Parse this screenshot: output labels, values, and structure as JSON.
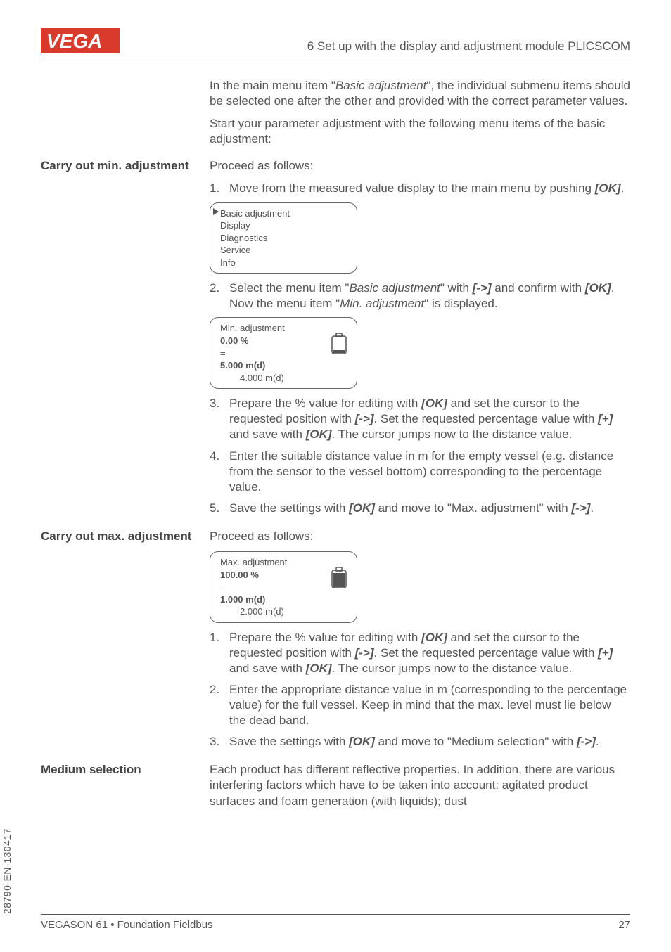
{
  "header": {
    "section_title": "6 Set up with the display and adjustment module PLICSCOM"
  },
  "intro": {
    "p1_a": "In the main menu item \"",
    "p1_i": "Basic adjustment",
    "p1_b": "\", the individual submenu items should be selected one after the other and provided with the correct parameter values.",
    "p2": "Start your parameter adjustment with the following menu items of the basic adjustment:"
  },
  "min": {
    "heading": "Carry out min. adjustment",
    "lead": "Proceed as follows:",
    "step1_a": "Move from the measured value display to the main menu by pushing ",
    "step1_ok": "[OK]",
    "step1_b": ".",
    "lcd1": {
      "l1": "Basic adjustment",
      "l2": "Display",
      "l3": "Diagnostics",
      "l4": "Service",
      "l5": "Info"
    },
    "step2_a": "Select the menu item \"",
    "step2_i1": "Basic adjustment",
    "step2_b": "\" with ",
    "step2_arrow": "[->]",
    "step2_c": " and confirm with ",
    "step2_ok": "[OK]",
    "step2_d": ". Now the menu item \"",
    "step2_i2": "Min. adjustment",
    "step2_e": "\" is displayed.",
    "lcd2": {
      "l1": "Min. adjustment",
      "l2": "0.00 %",
      "l3": "=",
      "l4": "5.000 m(d)",
      "l5": "4.000 m(d)"
    },
    "step3_a": "Prepare the % value for editing with ",
    "step3_ok1": "[OK]",
    "step3_b": " and set the cursor to the requested position with ",
    "step3_arrow": "[->]",
    "step3_c": ". Set the requested percentage value with ",
    "step3_plus": "[+]",
    "step3_d": " and save with ",
    "step3_ok2": "[OK]",
    "step3_e": ". The cursor jumps now to the distance value.",
    "step4": "Enter the suitable distance value in m for the empty vessel (e.g. distance from the sensor to the vessel bottom) corresponding to the percentage value.",
    "step5_a": "Save the settings with ",
    "step5_ok": "[OK]",
    "step5_b": " and move to \"Max. adjustment\" with ",
    "step5_arrow": "[->]",
    "step5_c": "."
  },
  "max": {
    "heading": "Carry out max. adjustment",
    "lead": "Proceed as follows:",
    "lcd": {
      "l1": "Max. adjustment",
      "l2": "100.00 %",
      "l3": "=",
      "l4": "1.000 m(d)",
      "l5": "2.000 m(d)"
    },
    "step1_a": "Prepare the % value for editing with ",
    "step1_ok1": "[OK]",
    "step1_b": " and set the cursor to the requested position with ",
    "step1_arrow": "[->]",
    "step1_c": ". Set the requested percentage value with ",
    "step1_plus": "[+]",
    "step1_d": " and save with ",
    "step1_ok2": "[OK]",
    "step1_e": ". The cursor jumps now to the distance value.",
    "step2": "Enter the appropriate distance value in m (corresponding to the percentage value) for the full vessel. Keep in mind that the max. level must lie below the dead band.",
    "step3_a": "Save the settings with ",
    "step3_ok": "[OK]",
    "step3_b": " and move to \"Medium selection\" with ",
    "step3_arrow": "[->]",
    "step3_c": "."
  },
  "medium": {
    "heading": "Medium selection",
    "p": "Each product has different reflective properties. In addition, there are various interfering factors which have to be taken into account: agitated product surfaces and foam generation (with liquids); dust"
  },
  "footer": {
    "left": "VEGASON 61 • Foundation Fieldbus",
    "right": "27",
    "doc_code": "28790-EN-130417"
  }
}
